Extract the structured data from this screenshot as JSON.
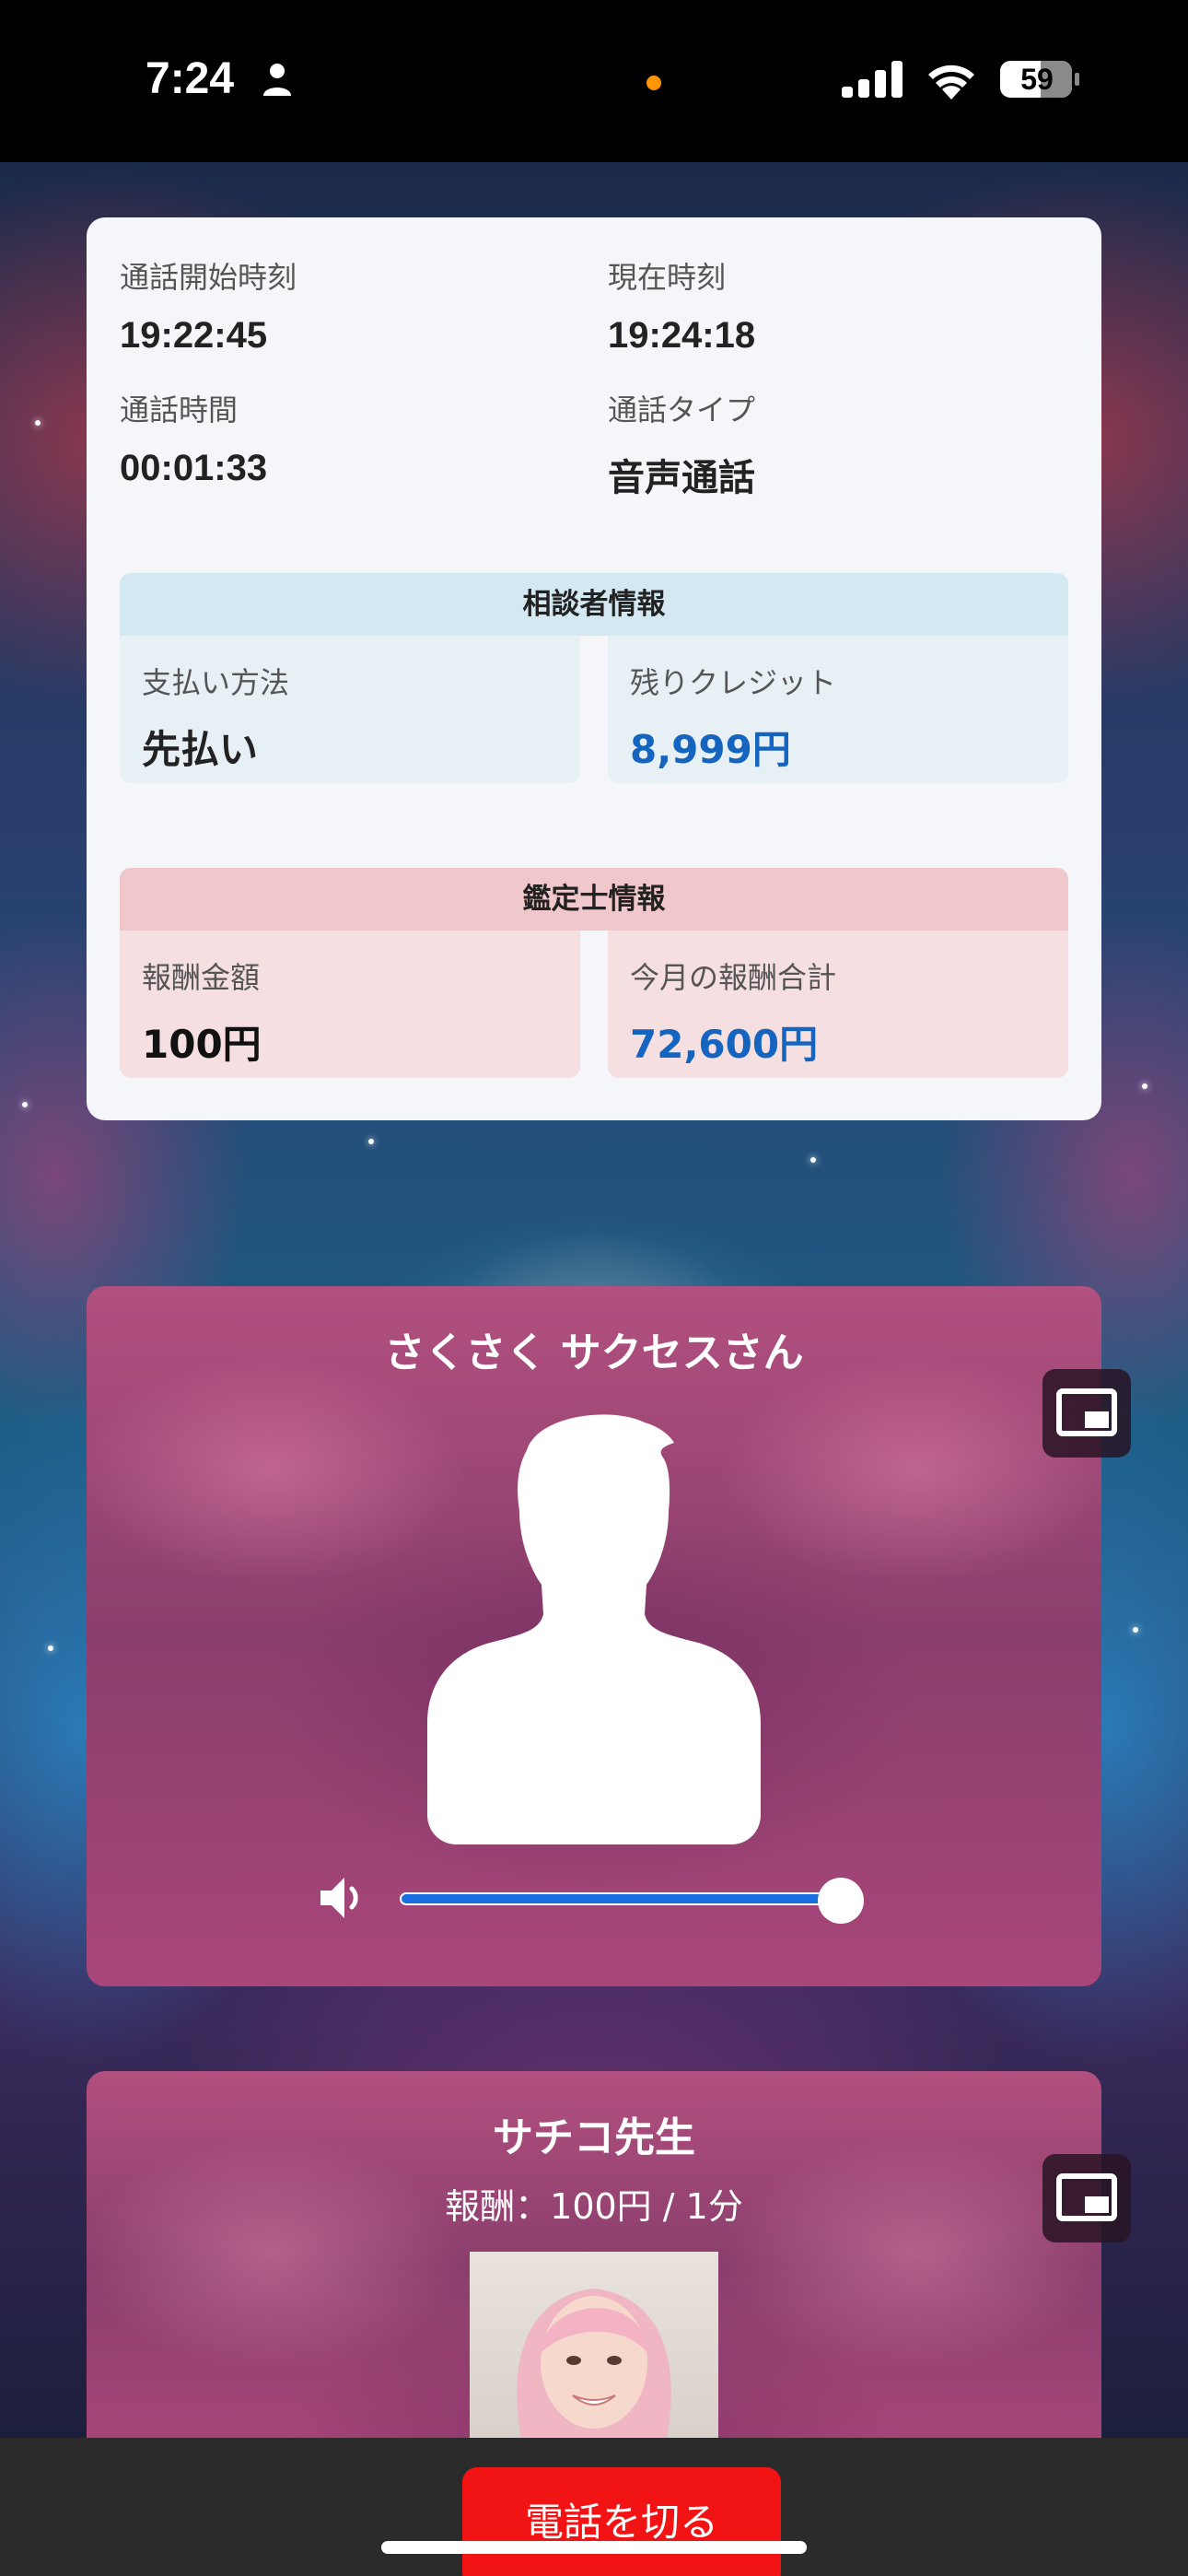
{
  "status_bar": {
    "time": "7:24",
    "battery": "59",
    "icons": [
      "person-icon",
      "signal-icon",
      "wifi-icon",
      "battery-icon"
    ],
    "privacy_dot_color": "#ff9500"
  },
  "call_info": {
    "start_time_label": "通話開始時刻",
    "start_time": "19:22:45",
    "current_time_label": "現在時刻",
    "current_time": "19:24:18",
    "duration_label": "通話時間",
    "duration": "00:01:33",
    "type_label": "通話タイプ",
    "type": "音声通話"
  },
  "client_info": {
    "header": "相談者情報",
    "header_color": "#d3e8f0",
    "box_color": "#e7f0f5",
    "payment_label": "支払い方法",
    "payment": "先払い",
    "credit_label": "残りクレジット",
    "credit": "8,999円",
    "credit_color": "#1565c0"
  },
  "advisor_info": {
    "header": "鑑定士情報",
    "header_color": "#f0c7ca",
    "box_color": "#f5dfe1",
    "fee_label": "報酬金額",
    "fee": "100円",
    "month_total_label": "今月の報酬合計",
    "month_total": "72,600円",
    "month_total_color": "#1565c0"
  },
  "client_card": {
    "name": "さくさく サクセスさん",
    "volume": 1.0
  },
  "advisor_card": {
    "name": "サチコ先生",
    "rate": "報酬：100円 / 1分"
  },
  "hangup_label": "電話を切る",
  "hangup_color": "#f21414"
}
